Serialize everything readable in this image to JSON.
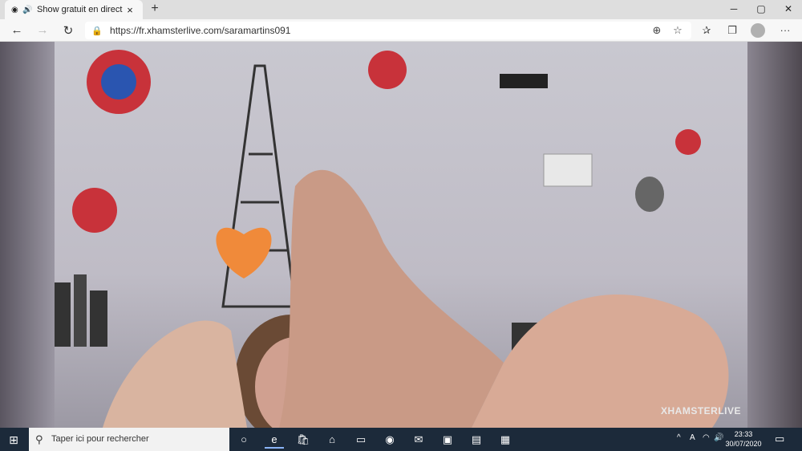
{
  "tab": {
    "title": "Show gratuit en direct par v",
    "close": "×"
  },
  "newtab": "+",
  "window": {
    "min": "─",
    "max": "▢",
    "close": "✕"
  },
  "nav": {
    "back": "←",
    "forward": "→",
    "refresh": "↻"
  },
  "address": {
    "url": "https://fr.xhamsterlive.com/saramartins091",
    "lock": "🔒"
  },
  "toolbar": {
    "reader": "⊕",
    "fav": "☆",
    "favorites": "✰",
    "collections": "❐",
    "more": "···"
  },
  "video": {
    "watermark": "XHAMSTERLIVE"
  },
  "taskbar": {
    "start": "⊞",
    "search_placeholder": "Taper ici pour rechercher",
    "search_icon": "⚲",
    "cortana": "○",
    "apps": [
      "e",
      "🛍",
      "⌂",
      "▭",
      "◉",
      "✉",
      "▣",
      "▤",
      "▦"
    ]
  },
  "tray": {
    "chevron": "^",
    "antivirus": "A",
    "network": "◠",
    "volume": "🔊"
  },
  "clock": {
    "time": "23:33",
    "date": "30/07/2020"
  },
  "notifications": "▭"
}
